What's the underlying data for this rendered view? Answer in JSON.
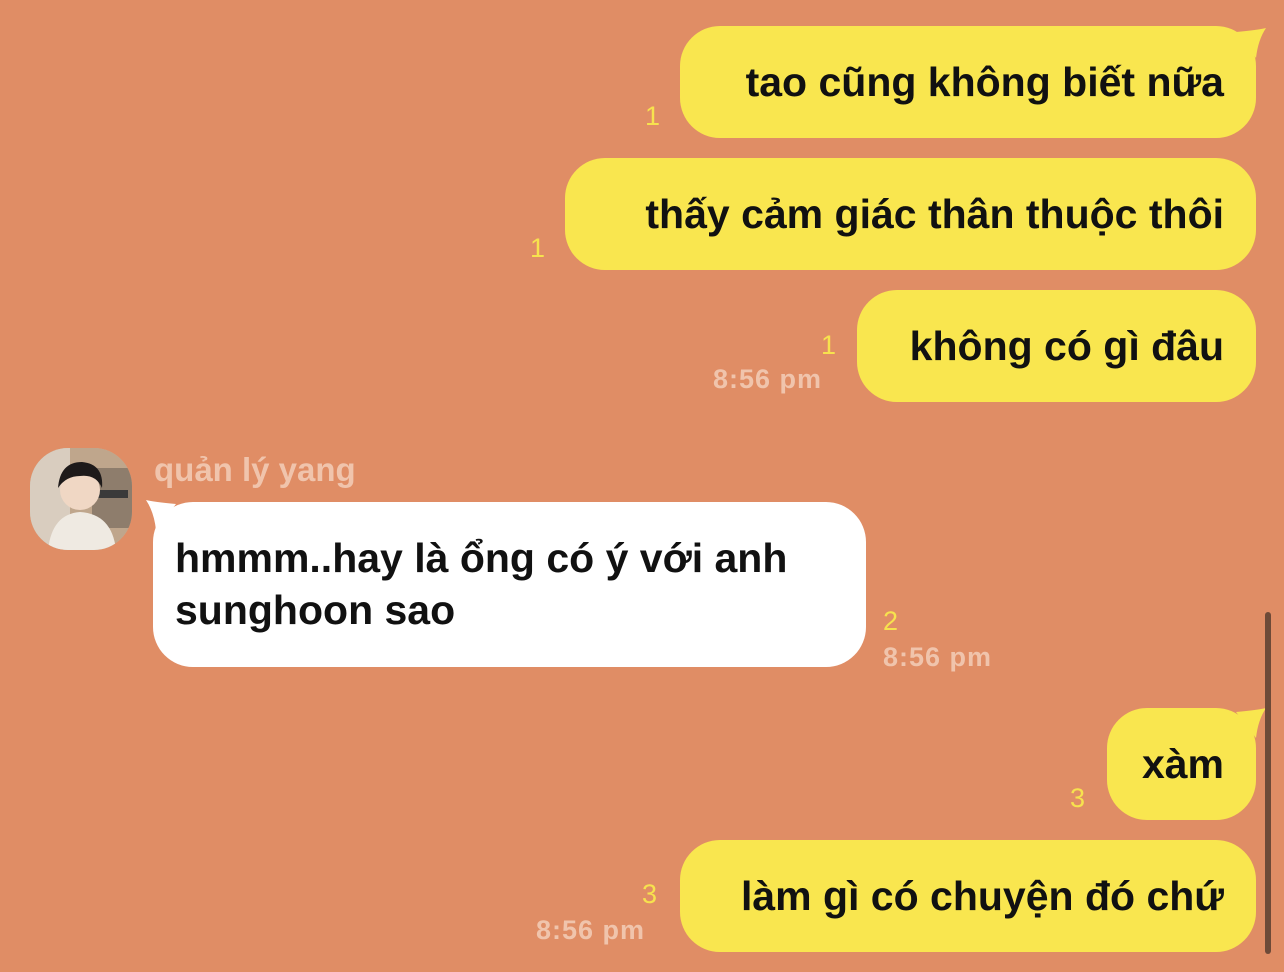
{
  "messages": [
    {
      "text": "tao cũng không biết nữa",
      "unread": "1"
    },
    {
      "text": "thấy cảm giác thân thuộc thôi",
      "unread": "1"
    },
    {
      "text": "không có gì đâu",
      "unread": "1",
      "time": "8:56 pm"
    },
    {
      "sender": "quản lý yang",
      "text": "hmmm..hay là ổng có ý với anh sunghoon sao",
      "unread": "2",
      "time": "8:56 pm",
      "avatar_icon": "profile-photo"
    },
    {
      "text": "xàm",
      "unread": "3"
    },
    {
      "text": "làm gì có chuyện đó chứ",
      "unread": "3",
      "time": "8:56 pm"
    }
  ],
  "colors": {
    "background": "#E08D65",
    "outgoing_bubble": "#F9E64F",
    "incoming_bubble": "#FFFFFF",
    "unread_count": "#F7E24E",
    "timestamp": "#F0C4AC"
  }
}
